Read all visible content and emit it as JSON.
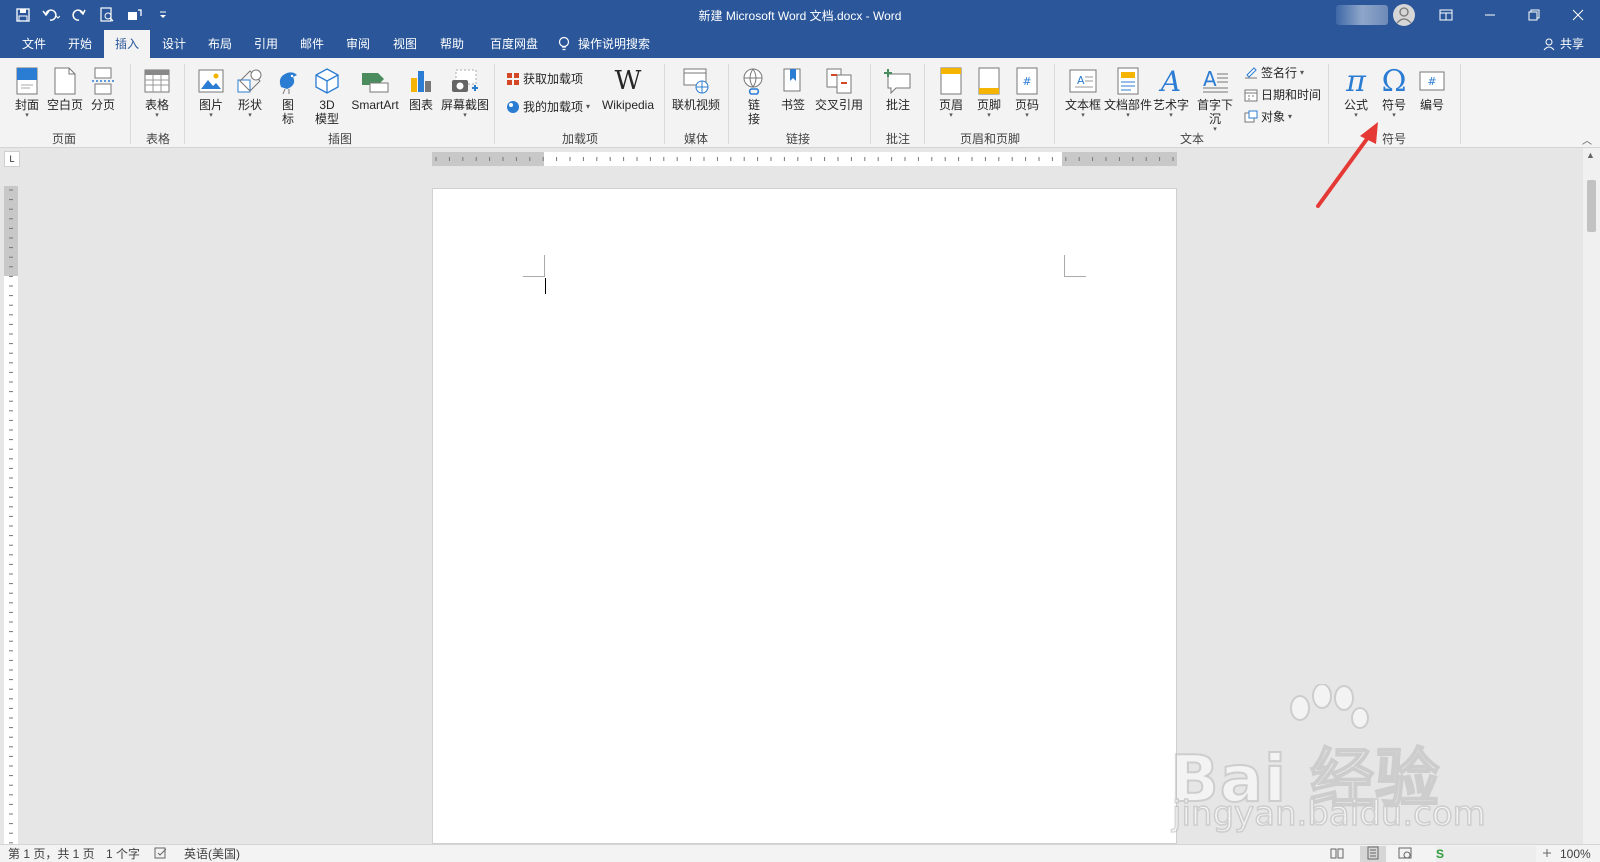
{
  "window": {
    "title": "新建 Microsoft Word 文档.docx  -  Word",
    "qat_icons": [
      "save-icon",
      "undo-icon",
      "redo-icon",
      "print-preview-icon",
      "touch-mode-icon",
      "customize-qat-icon"
    ],
    "window_icons": [
      "ribbon-display-icon",
      "minimize-icon",
      "restore-icon",
      "close-icon"
    ]
  },
  "tabs": [
    {
      "label": "文件"
    },
    {
      "label": "开始"
    },
    {
      "label": "插入"
    },
    {
      "label": "设计"
    },
    {
      "label": "布局"
    },
    {
      "label": "引用"
    },
    {
      "label": "邮件"
    },
    {
      "label": "审阅"
    },
    {
      "label": "视图"
    },
    {
      "label": "帮助"
    },
    {
      "label": "百度网盘"
    }
  ],
  "active_tab": "插入",
  "tell_me": "操作说明搜索",
  "share_label": "共享",
  "ribbon": {
    "page_group": {
      "label": "页面",
      "cover": "封面",
      "blank": "空白页",
      "break": "分页"
    },
    "table_group": {
      "label": "表格",
      "table": "表格"
    },
    "illust_group": {
      "label": "插图",
      "picture": "图片",
      "shapes": "形状",
      "icons_a": "图",
      "icons_b": "标",
      "model_a": "3D",
      "model_b": "模型",
      "smartart": "SmartArt",
      "chart": "图表",
      "screenshot": "屏幕截图"
    },
    "addin_group": {
      "label": "加载项",
      "get": "获取加载项",
      "mine": "我的加载项",
      "wiki": "Wikipedia"
    },
    "media_group": {
      "label": "媒体",
      "video": "联机视频"
    },
    "link_group": {
      "label": "链接",
      "link_a": "链",
      "link_b": "接",
      "bookmark": "书签",
      "crossref": "交叉引用"
    },
    "comment_group": {
      "label": "批注",
      "comment": "批注"
    },
    "hf_group": {
      "label": "页眉和页脚",
      "header": "页眉",
      "footer": "页脚",
      "pagenum": "页码"
    },
    "text_group": {
      "label": "文本",
      "textbox": "文本框",
      "parts": "文档部件",
      "wordart": "艺术字",
      "dropcap": "首字下沉",
      "sigline": "签名行",
      "datetime": "日期和时间",
      "object": "对象"
    },
    "symbol_group": {
      "label": "符号",
      "equation": "公式",
      "symbol": "符号",
      "number": "编号"
    }
  },
  "status": {
    "page": "第 1 页，共 1 页",
    "words": "1 个字",
    "language": "英语(美国)",
    "zoom": "100%"
  },
  "watermark": {
    "brand": "Bai  经验",
    "url": "jingyan.baidu.com"
  },
  "colors": {
    "titlebar": "#2b579a",
    "ribbon": "#f3f3f3",
    "accent": "#2b579a",
    "arrow": "#e53935"
  }
}
